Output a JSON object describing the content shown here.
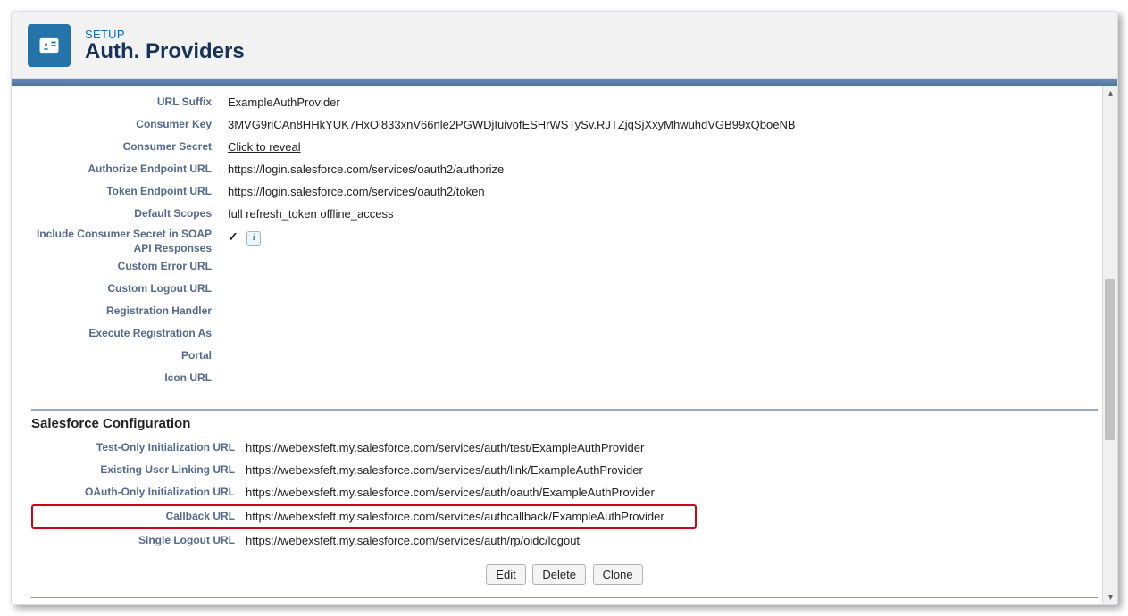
{
  "header": {
    "eyebrow": "SETUP",
    "title": "Auth. Providers"
  },
  "details": {
    "url_suffix_label": "URL Suffix",
    "url_suffix": "ExampleAuthProvider",
    "consumer_key_label": "Consumer Key",
    "consumer_key": "3MVG9riCAn8HHkYUK7HxOl833xnV66nle2PGWDjIuivofESHrWSTySv.RJTZjqSjXxyMhwuhdVGB99xQboeNB",
    "consumer_secret_label": "Consumer Secret",
    "consumer_secret_action": "Click to reveal",
    "authorize_endpoint_label": "Authorize Endpoint URL",
    "authorize_endpoint": "https://login.salesforce.com/services/oauth2/authorize",
    "token_endpoint_label": "Token Endpoint URL",
    "token_endpoint": "https://login.salesforce.com/services/oauth2/token",
    "default_scopes_label": "Default Scopes",
    "default_scopes": "full refresh_token offline_access",
    "include_secret_label": "Include Consumer Secret in SOAP API Responses",
    "include_secret_checked": "✓",
    "custom_error_url_label": "Custom Error URL",
    "custom_error_url": "",
    "custom_logout_url_label": "Custom Logout URL",
    "custom_logout_url": "",
    "registration_handler_label": "Registration Handler",
    "registration_handler": "",
    "execute_registration_as_label": "Execute Registration As",
    "execute_registration_as": "",
    "portal_label": "Portal",
    "portal": "",
    "icon_url_label": "Icon URL",
    "icon_url": ""
  },
  "salesforce_config": {
    "section_title": "Salesforce Configuration",
    "test_init_label": "Test-Only Initialization URL",
    "test_init": "https://webexsfeft.my.salesforce.com/services/auth/test/ExampleAuthProvider",
    "existing_link_label": "Existing User Linking URL",
    "existing_link": "https://webexsfeft.my.salesforce.com/services/auth/link/ExampleAuthProvider",
    "oauth_init_label": "OAuth-Only Initialization URL",
    "oauth_init": "https://webexsfeft.my.salesforce.com/services/auth/oauth/ExampleAuthProvider",
    "callback_label": "Callback URL",
    "callback": "https://webexsfeft.my.salesforce.com/services/authcallback/ExampleAuthProvider",
    "slo_label": "Single Logout URL",
    "slo": "https://webexsfeft.my.salesforce.com/services/auth/rp/oidc/logout"
  },
  "buttons": {
    "edit": "Edit",
    "delete": "Delete",
    "clone": "Clone"
  }
}
